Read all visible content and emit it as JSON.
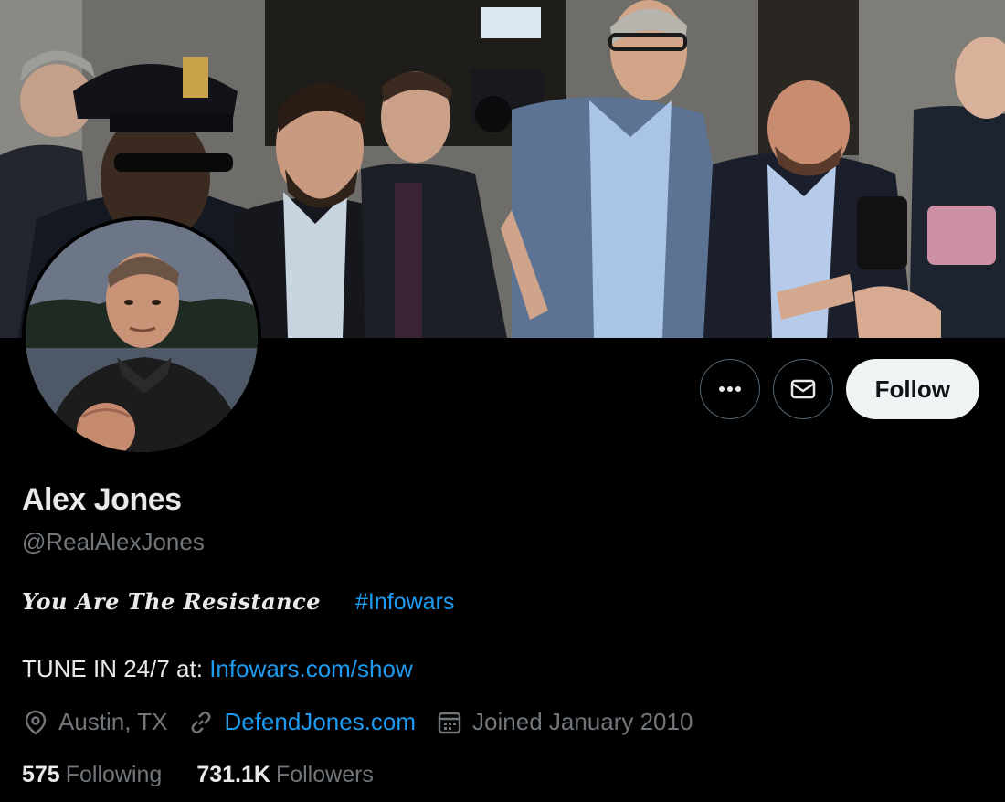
{
  "profile": {
    "name": "Alex Jones",
    "handle": "@RealAlexJones",
    "bio_tagline": "You Are The Resistance",
    "bio_hashtag": "#Infowars",
    "bio_tune_prefix": "TUNE IN 24/7 at:",
    "bio_tune_link": "Infowars.com/show",
    "location": "Austin, TX",
    "website": "DefendJones.com",
    "joined": "Joined January 2010",
    "following_count": "575",
    "following_label": "Following",
    "followers_count": "731.1K",
    "followers_label": "Followers"
  },
  "actions": {
    "more_icon": "more-horizontal-icon",
    "message_icon": "envelope-icon",
    "follow_label": "Follow"
  },
  "colors": {
    "background": "#000000",
    "link": "#1d9bf0",
    "muted": "#71767b",
    "text": "#e7e9ea",
    "follow_bg": "#eff3f4"
  }
}
